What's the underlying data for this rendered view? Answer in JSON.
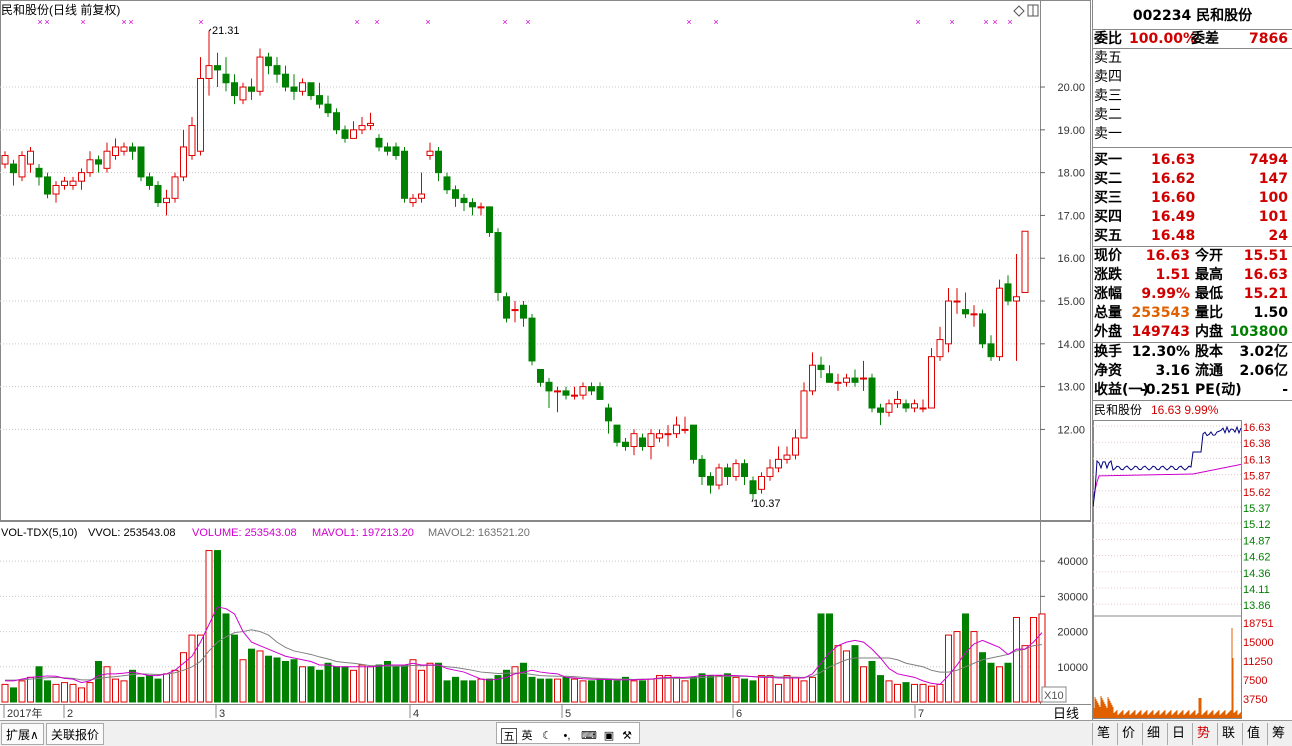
{
  "header": {
    "title": "民和股份(日线 前复权)"
  },
  "kline": {
    "ymin": 10,
    "ymax": 21.8,
    "yticks": [
      "20.00",
      "19.00",
      "18.00",
      "17.00",
      "16.00",
      "15.00",
      "14.00",
      "13.00",
      "12.00"
    ],
    "high_label": "21.31",
    "low_label": "10.37",
    "candles": [
      [
        18.2,
        18.4,
        18.5,
        18.1
      ],
      [
        18.2,
        18.0,
        18.3,
        17.7
      ],
      [
        17.9,
        18.4,
        18.5,
        17.8
      ],
      [
        18.2,
        18.5,
        18.6,
        18.0
      ],
      [
        18.1,
        17.9,
        18.2,
        17.7
      ],
      [
        17.9,
        17.5,
        18.0,
        17.4
      ],
      [
        17.5,
        17.7,
        17.8,
        17.3
      ],
      [
        17.7,
        17.8,
        17.9,
        17.6
      ],
      [
        17.7,
        17.8,
        17.9,
        17.6
      ],
      [
        17.8,
        18.0,
        18.1,
        17.6
      ],
      [
        18.0,
        18.3,
        18.5,
        17.9
      ],
      [
        18.3,
        18.2,
        18.4,
        18.0
      ],
      [
        18.1,
        18.5,
        18.7,
        18.0
      ],
      [
        18.4,
        18.6,
        18.8,
        18.3
      ],
      [
        18.5,
        18.6,
        18.7,
        18.4
      ],
      [
        18.6,
        18.5,
        18.7,
        18.3
      ],
      [
        18.6,
        17.9,
        18.6,
        17.8
      ],
      [
        17.9,
        17.7,
        18.0,
        17.6
      ],
      [
        17.7,
        17.3,
        17.8,
        17.2
      ],
      [
        17.3,
        17.4,
        17.6,
        17.0
      ],
      [
        17.4,
        17.9,
        18.0,
        17.3
      ],
      [
        17.9,
        18.6,
        19.0,
        17.8
      ],
      [
        18.4,
        19.1,
        19.3,
        18.3
      ],
      [
        18.5,
        20.2,
        20.7,
        18.4
      ],
      [
        20.2,
        20.5,
        21.31,
        19.8
      ],
      [
        20.5,
        20.4,
        20.8,
        20.0
      ],
      [
        20.3,
        20.1,
        20.7,
        19.9
      ],
      [
        20.1,
        19.8,
        20.3,
        19.6
      ],
      [
        19.7,
        20.0,
        20.1,
        19.6
      ],
      [
        20.0,
        19.9,
        20.2,
        19.7
      ],
      [
        19.9,
        20.7,
        20.9,
        19.8
      ],
      [
        20.7,
        20.5,
        20.8,
        20.3
      ],
      [
        20.5,
        20.3,
        20.7,
        20.1
      ],
      [
        20.3,
        20.0,
        20.5,
        19.9
      ],
      [
        20.0,
        19.9,
        20.3,
        19.7
      ],
      [
        19.9,
        20.1,
        20.2,
        19.8
      ],
      [
        20.1,
        19.8,
        20.1,
        19.7
      ],
      [
        19.8,
        19.6,
        20.1,
        19.5
      ],
      [
        19.6,
        19.4,
        19.8,
        19.3
      ],
      [
        19.4,
        19.0,
        19.5,
        18.9
      ],
      [
        19.0,
        18.8,
        19.1,
        18.7
      ],
      [
        18.8,
        19.0,
        19.2,
        18.8
      ],
      [
        19.0,
        19.1,
        19.3,
        18.9
      ],
      [
        19.1,
        19.15,
        19.4,
        19.0
      ],
      [
        18.8,
        18.6,
        18.9,
        18.5
      ],
      [
        18.6,
        18.5,
        18.7,
        18.4
      ],
      [
        18.6,
        18.4,
        18.7,
        18.3
      ],
      [
        18.5,
        17.4,
        18.6,
        17.3
      ],
      [
        17.3,
        17.4,
        17.5,
        17.2
      ],
      [
        17.4,
        17.5,
        18.0,
        17.3
      ],
      [
        18.4,
        18.5,
        18.7,
        18.3
      ],
      [
        18.5,
        18.0,
        18.6,
        17.8
      ],
      [
        17.9,
        17.6,
        18.0,
        17.5
      ],
      [
        17.6,
        17.4,
        17.7,
        17.2
      ],
      [
        17.4,
        17.3,
        17.5,
        17.1
      ],
      [
        17.3,
        17.2,
        17.4,
        17.0
      ],
      [
        17.2,
        17.2,
        17.3,
        17.0
      ],
      [
        17.2,
        16.6,
        17.2,
        16.5
      ],
      [
        16.6,
        15.2,
        16.7,
        15.0
      ],
      [
        15.1,
        14.6,
        15.2,
        14.5
      ],
      [
        14.8,
        14.8,
        15.0,
        14.5
      ],
      [
        14.9,
        14.6,
        15.0,
        14.4
      ],
      [
        14.6,
        13.6,
        14.7,
        13.5
      ],
      [
        13.4,
        13.1,
        13.4,
        13.0
      ],
      [
        13.1,
        12.9,
        13.2,
        12.5
      ],
      [
        12.9,
        12.9,
        13.0,
        12.4
      ],
      [
        12.9,
        12.8,
        13.0,
        12.7
      ],
      [
        12.8,
        12.8,
        13.0,
        12.7
      ],
      [
        12.8,
        13.0,
        13.1,
        12.7
      ],
      [
        13.0,
        12.9,
        13.1,
        12.8
      ],
      [
        13.0,
        12.7,
        13.1,
        12.7
      ],
      [
        12.5,
        12.2,
        12.6,
        11.9
      ],
      [
        12.1,
        11.7,
        12.1,
        11.6
      ],
      [
        11.7,
        11.6,
        11.8,
        11.5
      ],
      [
        11.6,
        11.9,
        12.0,
        11.4
      ],
      [
        11.8,
        11.6,
        11.9,
        11.5
      ],
      [
        11.6,
        11.9,
        12.0,
        11.3
      ],
      [
        11.8,
        11.9,
        12.0,
        11.7
      ],
      [
        11.9,
        11.9,
        12.1,
        11.6
      ],
      [
        11.9,
        12.1,
        12.3,
        11.8
      ],
      [
        12.0,
        12.0,
        12.3,
        11.9
      ],
      [
        12.1,
        11.3,
        12.1,
        11.2
      ],
      [
        11.3,
        10.9,
        11.4,
        10.7
      ],
      [
        10.9,
        10.7,
        11.0,
        10.5
      ],
      [
        10.7,
        11.1,
        11.2,
        10.6
      ],
      [
        11.1,
        10.9,
        11.2,
        10.7
      ],
      [
        10.9,
        11.2,
        11.3,
        10.8
      ],
      [
        11.2,
        10.9,
        11.3,
        10.7
      ],
      [
        10.8,
        10.5,
        10.9,
        10.37
      ],
      [
        10.6,
        10.9,
        11.0,
        10.5
      ],
      [
        10.9,
        11.1,
        11.3,
        10.8
      ],
      [
        11.1,
        11.3,
        11.6,
        11.0
      ],
      [
        11.3,
        11.4,
        11.6,
        11.2
      ],
      [
        11.4,
        11.8,
        12.0,
        11.3
      ],
      [
        11.8,
        12.9,
        13.1,
        11.8
      ],
      [
        12.9,
        13.5,
        13.8,
        12.8
      ],
      [
        13.5,
        13.4,
        13.7,
        13.2
      ],
      [
        13.3,
        13.1,
        13.5,
        13.1
      ],
      [
        13.1,
        13.1,
        13.3,
        12.9
      ],
      [
        13.1,
        13.2,
        13.3,
        13.0
      ],
      [
        13.2,
        13.1,
        13.4,
        13.0
      ],
      [
        13.2,
        13.2,
        13.6,
        12.9
      ],
      [
        13.2,
        12.5,
        13.3,
        12.4
      ],
      [
        12.5,
        12.4,
        12.6,
        12.1
      ],
      [
        12.4,
        12.6,
        12.7,
        12.3
      ],
      [
        12.6,
        12.7,
        12.9,
        12.5
      ],
      [
        12.6,
        12.5,
        12.7,
        12.4
      ],
      [
        12.5,
        12.6,
        12.7,
        12.4
      ],
      [
        12.5,
        12.5,
        12.7,
        12.4
      ],
      [
        12.5,
        13.7,
        13.9,
        12.5
      ],
      [
        13.7,
        14.1,
        14.4,
        13.6
      ],
      [
        14.0,
        15.0,
        15.3,
        13.8
      ],
      [
        15.0,
        15.0,
        15.3,
        14.7
      ],
      [
        14.8,
        14.7,
        15.2,
        14.6
      ],
      [
        14.7,
        14.7,
        14.9,
        14.4
      ],
      [
        14.7,
        14.0,
        14.8,
        13.9
      ],
      [
        14.0,
        13.7,
        14.2,
        13.6
      ],
      [
        13.7,
        15.3,
        15.5,
        13.6
      ],
      [
        15.4,
        15.0,
        15.6,
        14.9
      ],
      [
        15.0,
        15.1,
        16.1,
        13.6
      ],
      [
        15.2,
        16.63,
        16.63,
        15.21
      ]
    ],
    "markers": [
      40,
      47,
      83,
      124,
      131,
      201,
      357,
      377,
      428,
      505,
      528,
      689,
      716,
      918,
      952,
      986,
      995,
      1010
    ]
  },
  "volume": {
    "header": {
      "name": "VOL-TDX(5,10)",
      "vvol": "VVOL: 253543.08",
      "volume": "VOLUME: 253543.08",
      "mavol1": "MAVOL1: 197213.20",
      "mavol2": "MAVOL2: 163521.20"
    },
    "ymax": 46000,
    "yticks": [
      "40000",
      "30000",
      "20000",
      "10000"
    ],
    "x10": "X10",
    "values": [
      5000,
      4000,
      6000,
      7000,
      10000,
      6000,
      5000,
      5500,
      5000,
      4000,
      5500,
      11500,
      10000,
      6500,
      6000,
      9000,
      7000,
      7500,
      6500,
      8000,
      9000,
      14000,
      19000,
      19000,
      43000,
      43000,
      25000,
      19000,
      12000,
      15000,
      14500,
      13000,
      12500,
      11500,
      12000,
      10000,
      10000,
      9000,
      11000,
      10000,
      10000,
      9000,
      10500,
      10000,
      10500,
      11500,
      10000,
      10500,
      12000,
      9000,
      11000,
      11000,
      6000,
      7000,
      6000,
      6000,
      6500,
      6500,
      7500,
      9000,
      10000,
      11000,
      7000,
      6500,
      6500,
      6500,
      7000,
      6500,
      6000,
      6000,
      6500,
      6500,
      6000,
      7000,
      6000,
      6000,
      6500,
      7500,
      7500,
      7000,
      6000,
      7000,
      8000,
      7500,
      7500,
      8000,
      7000,
      6500,
      6000,
      7500,
      7500,
      5000,
      7500,
      7000,
      6000,
      7000,
      25000,
      25000,
      16000,
      14500,
      16000,
      10000,
      11500,
      7500,
      6000,
      5000,
      5500,
      5000,
      5000,
      4500,
      5000,
      19000,
      20000,
      25000,
      20000,
      14000,
      11000,
      10000,
      11000,
      24000,
      16000,
      24000,
      25000
    ],
    "mavol1": [
      6000,
      6000,
      6500,
      7000,
      7200,
      7400,
      7300,
      6700,
      6500,
      5500,
      6000,
      7500,
      8000,
      8000,
      8200,
      8500,
      8000,
      7500,
      7500,
      8000,
      9000,
      11000,
      13000,
      17000,
      22000,
      27000,
      26500,
      25000,
      20000,
      17000,
      16000,
      15000,
      14000,
      13000,
      12500,
      12000,
      11500,
      10500,
      10500,
      10000,
      10000,
      10000,
      10000,
      10000,
      10200,
      10500,
      10500,
      10500,
      11000,
      10500,
      10500,
      10500,
      9500,
      9000,
      8500,
      7500,
      6500,
      6200,
      6500,
      7000,
      8000,
      8500,
      9000,
      8500,
      8200,
      8000,
      7000,
      6800,
      6600,
      6500,
      6400,
      6400,
      6300,
      6300,
      6300,
      6400,
      6500,
      6800,
      7000,
      7000,
      7000,
      7200,
      7500,
      7600,
      7600,
      7600,
      7500,
      7400,
      7200,
      7000,
      7000,
      6800,
      6800,
      6800,
      6800,
      8000,
      11000,
      14000,
      16000,
      17000,
      17500,
      17000,
      15000,
      12500,
      9500,
      8000,
      7500,
      7000,
      6000,
      5300,
      5000,
      7500,
      10500,
      14000,
      16500,
      17500,
      16500,
      15500,
      13500,
      15000,
      15000,
      17000,
      19700
    ],
    "mavol2": [
      6200,
      6200,
      6300,
      6500,
      6700,
      6900,
      7000,
      6900,
      6700,
      6300,
      6300,
      6700,
      7000,
      7200,
      7500,
      7800,
      8000,
      7900,
      7800,
      7900,
      8300,
      9000,
      10000,
      11500,
      14500,
      17000,
      18500,
      19700,
      20000,
      20500,
      20000,
      19000,
      17000,
      15500,
      14500,
      14000,
      13500,
      12800,
      12200,
      11500,
      11200,
      11000,
      10700,
      10300,
      10300,
      10200,
      10200,
      10200,
      10400,
      10300,
      10400,
      10400,
      10000,
      9800,
      9400,
      9000,
      8500,
      8300,
      8100,
      8200,
      8200,
      8200,
      7800,
      7500,
      7400,
      7300,
      7300,
      7200,
      7000,
      6800,
      6700,
      6600,
      6500,
      6500,
      6400,
      6500,
      6500,
      6600,
      6700,
      6700,
      6700,
      6800,
      7000,
      7100,
      7200,
      7300,
      7300,
      7300,
      7200,
      7200,
      7300,
      7100,
      7100,
      7000,
      7000,
      7300,
      8500,
      10000,
      11000,
      12000,
      12500,
      12500,
      12500,
      12500,
      12500,
      12000,
      11000,
      10500,
      10000,
      9000,
      8500,
      8500,
      9000,
      10000,
      11000,
      12000,
      12500,
      13000,
      13500,
      14500,
      15000,
      16000,
      16300
    ]
  },
  "xaxis": {
    "labels": [
      "2017年",
      "2",
      "3",
      "4",
      "5",
      "6",
      "7"
    ],
    "tab": "日线"
  },
  "quote": {
    "title": "002234 民和股份",
    "weibi_label": "委比",
    "weibi": "100.00%",
    "weicha_label": "委差",
    "weicha": "7866",
    "sell": [
      {
        "label": "卖五"
      },
      {
        "label": "卖四"
      },
      {
        "label": "卖三"
      },
      {
        "label": "卖二"
      },
      {
        "label": "卖一"
      }
    ],
    "buy": [
      {
        "label": "买一",
        "price": "16.63",
        "vol": "7494"
      },
      {
        "label": "买二",
        "price": "16.62",
        "vol": "147"
      },
      {
        "label": "买三",
        "price": "16.60",
        "vol": "100"
      },
      {
        "label": "买四",
        "price": "16.49",
        "vol": "101"
      },
      {
        "label": "买五",
        "price": "16.48",
        "vol": "24"
      }
    ],
    "stats1": [
      {
        "l1": "现价",
        "v1": "16.63",
        "l2": "今开",
        "v2": "15.51"
      },
      {
        "l1": "涨跌",
        "v1": "1.51",
        "l2": "最高",
        "v2": "16.63"
      },
      {
        "l1": "涨幅",
        "v1": "9.99%",
        "l2": "最低",
        "v2": "15.21"
      },
      {
        "l1": "总量",
        "v1": "253543",
        "l2": "量比",
        "v2": "1.50"
      },
      {
        "l1": "外盘",
        "v1": "149743",
        "l2": "内盘",
        "v2": "103800"
      }
    ],
    "stats2": [
      {
        "l1": "换手",
        "v1": "12.30%",
        "l2": "股本",
        "v2": "3.02亿"
      },
      {
        "l1": "净资",
        "v1": "3.16",
        "l2": "流通",
        "v2": "2.06亿"
      },
      {
        "l1": "收益(一)",
        "v1": "-0.251",
        "l2": "PE(动)",
        "v2": "-"
      }
    ],
    "mini_title": "民和股份",
    "mini_price": "16.63 9.99%",
    "mini_price_ticks": [
      "16.63",
      "16.38",
      "16.13",
      "15.87",
      "15.62",
      "15.37",
      "15.12",
      "14.87",
      "14.62",
      "14.36",
      "14.11",
      "13.86"
    ],
    "mini_vol_ticks": [
      "18751",
      "15000",
      "11250",
      "7500",
      "3750"
    ]
  },
  "bottom": {
    "tab1": "扩展",
    "tab1_arrow": "∧",
    "tab2": "关联报价",
    "ime_labels": [
      "五",
      "英"
    ],
    "right_tabs": [
      "笔",
      "价",
      "细",
      "日",
      "势",
      "联",
      "值",
      "筹"
    ]
  }
}
